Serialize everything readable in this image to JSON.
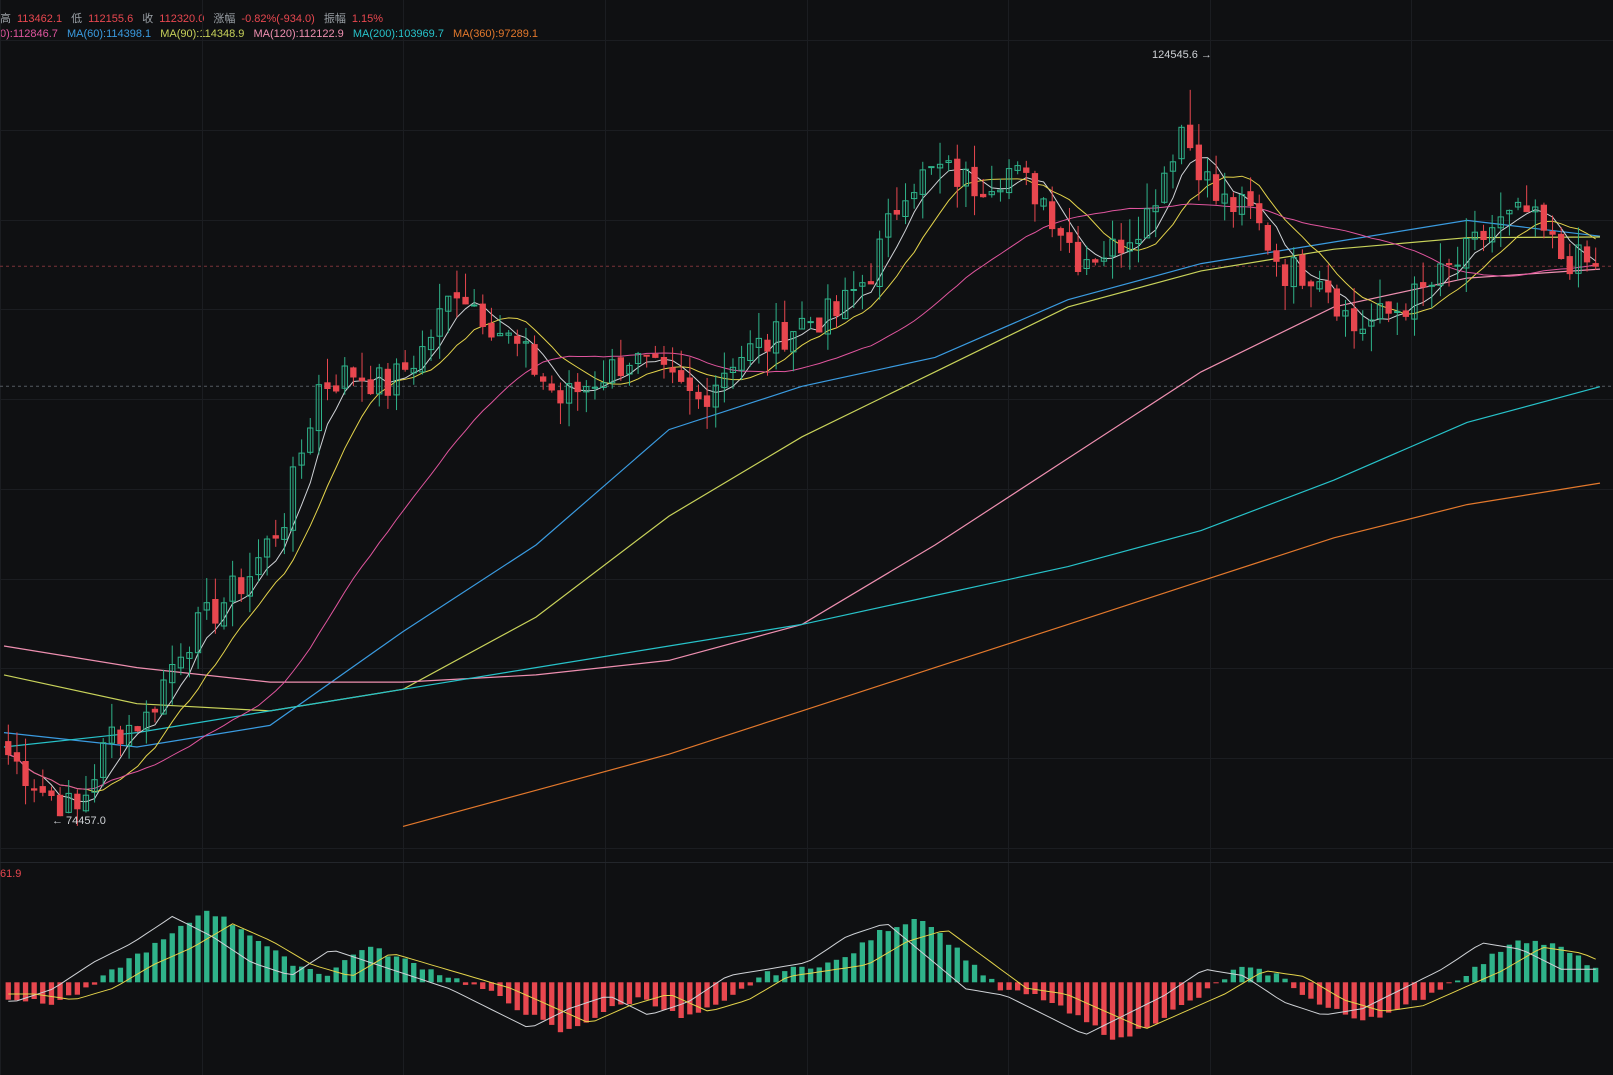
{
  "header": {
    "high_label": "高",
    "high_value": "113462.1",
    "low_label": "低",
    "low_value": "112155.6",
    "close_label": "收",
    "close_value": "112320.0",
    "change_label": "涨幅",
    "change_value": "-0.82%(-934.0)",
    "amplitude_label": "振幅",
    "amplitude_value": "1.15%"
  },
  "ma_legend": [
    {
      "text": "0):112846.7",
      "color": "#e0559e"
    },
    {
      "text": "MA(60):114398.1",
      "color": "#3a9be0"
    },
    {
      "text": "MA(90):114348.9",
      "color": "#c8d25a"
    },
    {
      "text": "MA(120):112122.9",
      "color": "#ee8fb0"
    },
    {
      "text": "MA(200):103969.7",
      "color": "#27c2c9"
    },
    {
      "text": "MA(360):97289.1",
      "color": "#e2782c"
    }
  ],
  "annotations": {
    "high_marker": "124545.6 →",
    "low_marker": "← 74457.0",
    "macd_label": "61.9"
  },
  "colors": {
    "up": "#2fb38a",
    "down": "#e8474f",
    "background": "#0f1012",
    "grid": "#1b1d21",
    "macd_dif": "#cfd2d6",
    "macd_dea": "#e3d34b"
  },
  "chart_data": {
    "type": "candlestick",
    "price_ylim": [
      72000,
      128000
    ],
    "dashed_levels": [
      112320,
      104000
    ],
    "extremes": {
      "high": 124545.6,
      "low": 74457.0
    },
    "segments_price": [
      [
        0,
        78500
      ],
      [
        4,
        76000
      ],
      [
        8,
        74500
      ],
      [
        12,
        80000
      ],
      [
        16,
        81000
      ],
      [
        20,
        86000
      ],
      [
        24,
        88500
      ],
      [
        28,
        91000
      ],
      [
        32,
        95000
      ],
      [
        36,
        104000
      ],
      [
        40,
        105000
      ],
      [
        44,
        104000
      ],
      [
        48,
        106500
      ],
      [
        52,
        111000
      ],
      [
        56,
        108500
      ],
      [
        60,
        106000
      ],
      [
        64,
        103000
      ],
      [
        68,
        104500
      ],
      [
        72,
        106000
      ],
      [
        76,
        104500
      ],
      [
        80,
        103000
      ],
      [
        84,
        106000
      ],
      [
        88,
        107000
      ],
      [
        92,
        108500
      ],
      [
        96,
        109000
      ],
      [
        100,
        112000
      ],
      [
        104,
        118000
      ],
      [
        108,
        119000
      ],
      [
        112,
        118000
      ],
      [
        116,
        119000
      ],
      [
        120,
        117000
      ],
      [
        124,
        113000
      ],
      [
        128,
        113500
      ],
      [
        132,
        116000
      ],
      [
        136,
        122000
      ],
      [
        140,
        117000
      ],
      [
        144,
        116000
      ],
      [
        148,
        112000
      ],
      [
        152,
        112000
      ],
      [
        156,
        108000
      ],
      [
        160,
        109000
      ],
      [
        164,
        110500
      ],
      [
        168,
        112500
      ],
      [
        172,
        115000
      ],
      [
        176,
        116000
      ],
      [
        180,
        113000
      ],
      [
        184,
        112320
      ]
    ],
    "ma_series": [
      {
        "ma_key": "MA(60)",
        "values": [
          80000,
          79000,
          80500,
          87000,
          93000,
          101000,
          104000,
          106000,
          110000,
          112500,
          114000,
          115500,
          114400
        ]
      },
      {
        "ma_key": "MA(90)",
        "values": [
          84000,
          82000,
          81500,
          83000,
          88000,
          95000,
          100500,
          105000,
          109500,
          112000,
          113500,
          114300,
          114350
        ]
      },
      {
        "ma_key": "MA(120)",
        "values": [
          86000,
          84500,
          83500,
          83500,
          84000,
          85000,
          87500,
          93000,
          99000,
          105000,
          109500,
          111500,
          112120
        ]
      },
      {
        "ma_key": "MA(200)",
        "values": [
          79000,
          80000,
          81500,
          83000,
          84500,
          86000,
          87500,
          89500,
          91500,
          94000,
          97500,
          101500,
          103970
        ]
      },
      {
        "ma_key": "MA(360)",
        "values": [
          null,
          null,
          null,
          73500,
          76000,
          78500,
          81500,
          84500,
          87500,
          90500,
          93500,
          95800,
          97290
        ]
      }
    ],
    "macd": {
      "histogram_shape": [
        -2,
        -3,
        -1,
        3,
        6,
        10,
        7,
        3,
        1,
        5,
        3,
        1,
        -1,
        -4,
        -7,
        -4,
        -2,
        -5,
        -3,
        1,
        2,
        3,
        7,
        9,
        4,
        -1,
        -2,
        -5,
        -8,
        -5,
        -2,
        2,
        1,
        -3,
        -5,
        -4,
        -1,
        2,
        6,
        5,
        2
      ],
      "ylim": [
        -12,
        14
      ]
    }
  }
}
